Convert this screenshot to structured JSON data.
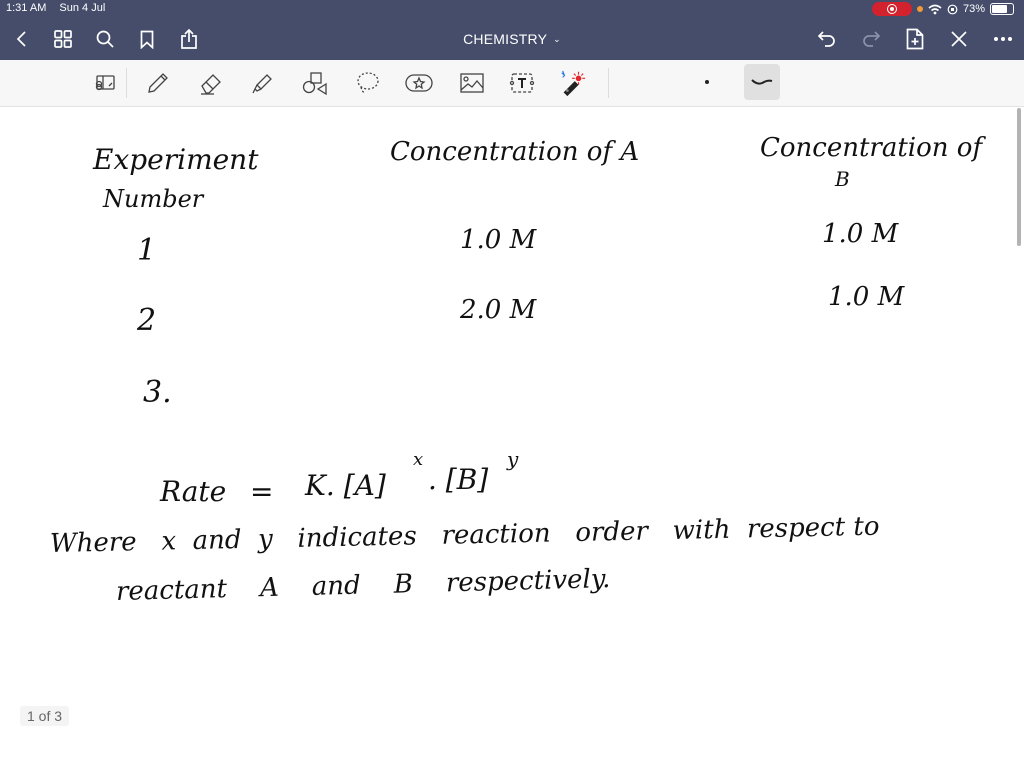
{
  "status_bar": {
    "time": "1:31 AM",
    "date": "Sun 4 Jul",
    "battery_percent": "73%",
    "battery_level": 0.73,
    "recording_color": "#d2222d"
  },
  "nav": {
    "title": "CHEMISTRY",
    "left_icons": [
      "back-icon",
      "grid-icon",
      "search-icon",
      "bookmark-icon",
      "share-icon"
    ],
    "right_icons": [
      "undo-icon",
      "redo-icon",
      "add-page-icon",
      "close-pen-icon",
      "more-icon"
    ],
    "bar_color": "#454d6b"
  },
  "toolbar": {
    "tools": [
      "reading-mode",
      "pen",
      "eraser",
      "highlighter",
      "shapes",
      "lasso",
      "stickers",
      "image",
      "text",
      "laser-pointer"
    ],
    "stroke_options": [
      "fine-dot",
      "medium-stroke"
    ]
  },
  "note": {
    "headers": {
      "experiment": "Experiment",
      "experiment_2": "Number",
      "conc_a": "Concentration of A",
      "conc_b": "Concentration of",
      "conc_b_2": "B"
    },
    "rows": [
      {
        "num": "1",
        "a": "1.0 M",
        "b": "1.0 M"
      },
      {
        "num": "2",
        "a": "2.0 M",
        "b": "1.0 M"
      },
      {
        "num": "3.",
        "a": "",
        "b": ""
      }
    ],
    "rate_lhs": "Rate",
    "rate_eq": "=",
    "rate_rhs": "K. [A]",
    "exp_x": "x",
    "rate_mid": ". [B]",
    "exp_y": "y",
    "line1": "Where   x  and  y   indicates   reaction   order   with  respect to",
    "line2": "reactant    A    and    B    respectively."
  },
  "page_indicator": "1 of 3"
}
